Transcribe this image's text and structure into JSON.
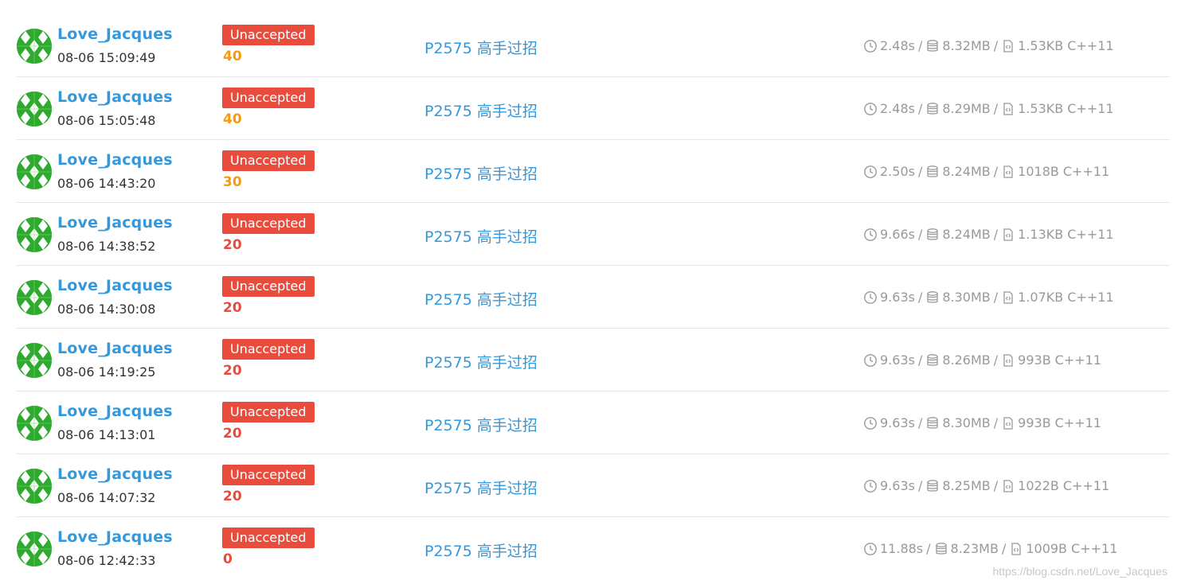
{
  "colors": {
    "link": "#3498db",
    "status_bg": "#e74c3c",
    "score_orange": "#f39c12",
    "score_red": "#e74c3c",
    "meta": "#999999"
  },
  "icons": {
    "avatar": "user-avatar",
    "time": "clock-icon",
    "memory": "database-icon",
    "code": "code-file-icon"
  },
  "records": [
    {
      "user": "Love_Jacques",
      "time": "08-06 15:09:49",
      "status": "Unaccepted",
      "score": "40",
      "score_color": "#f39c12",
      "problem": "P2575 高手过招",
      "runtime": "2.48s",
      "memory": "8.32MB",
      "code_size": "1.53KB",
      "language": "C++11"
    },
    {
      "user": "Love_Jacques",
      "time": "08-06 15:05:48",
      "status": "Unaccepted",
      "score": "40",
      "score_color": "#f39c12",
      "problem": "P2575 高手过招",
      "runtime": "2.48s",
      "memory": "8.29MB",
      "code_size": "1.53KB",
      "language": "C++11"
    },
    {
      "user": "Love_Jacques",
      "time": "08-06 14:43:20",
      "status": "Unaccepted",
      "score": "30",
      "score_color": "#f39c12",
      "problem": "P2575 高手过招",
      "runtime": "2.50s",
      "memory": "8.24MB",
      "code_size": "1018B",
      "language": "C++11"
    },
    {
      "user": "Love_Jacques",
      "time": "08-06 14:38:52",
      "status": "Unaccepted",
      "score": "20",
      "score_color": "#e74c3c",
      "problem": "P2575 高手过招",
      "runtime": "9.66s",
      "memory": "8.24MB",
      "code_size": "1.13KB",
      "language": "C++11"
    },
    {
      "user": "Love_Jacques",
      "time": "08-06 14:30:08",
      "status": "Unaccepted",
      "score": "20",
      "score_color": "#e74c3c",
      "problem": "P2575 高手过招",
      "runtime": "9.63s",
      "memory": "8.30MB",
      "code_size": "1.07KB",
      "language": "C++11"
    },
    {
      "user": "Love_Jacques",
      "time": "08-06 14:19:25",
      "status": "Unaccepted",
      "score": "20",
      "score_color": "#e74c3c",
      "problem": "P2575 高手过招",
      "runtime": "9.63s",
      "memory": "8.26MB",
      "code_size": "993B",
      "language": "C++11"
    },
    {
      "user": "Love_Jacques",
      "time": "08-06 14:13:01",
      "status": "Unaccepted",
      "score": "20",
      "score_color": "#e74c3c",
      "problem": "P2575 高手过招",
      "runtime": "9.63s",
      "memory": "8.30MB",
      "code_size": "993B",
      "language": "C++11"
    },
    {
      "user": "Love_Jacques",
      "time": "08-06 14:07:32",
      "status": "Unaccepted",
      "score": "20",
      "score_color": "#e74c3c",
      "problem": "P2575 高手过招",
      "runtime": "9.63s",
      "memory": "8.25MB",
      "code_size": "1022B",
      "language": "C++11"
    },
    {
      "user": "Love_Jacques",
      "time": "08-06 12:42:33",
      "status": "Unaccepted",
      "score": "0",
      "score_color": "#e74c3c",
      "problem": "P2575 高手过招",
      "runtime": "11.88s",
      "memory": "8.23MB",
      "code_size": "1009B",
      "language": "C++11"
    }
  ],
  "watermark": "https://blog.csdn.net/Love_Jacques"
}
